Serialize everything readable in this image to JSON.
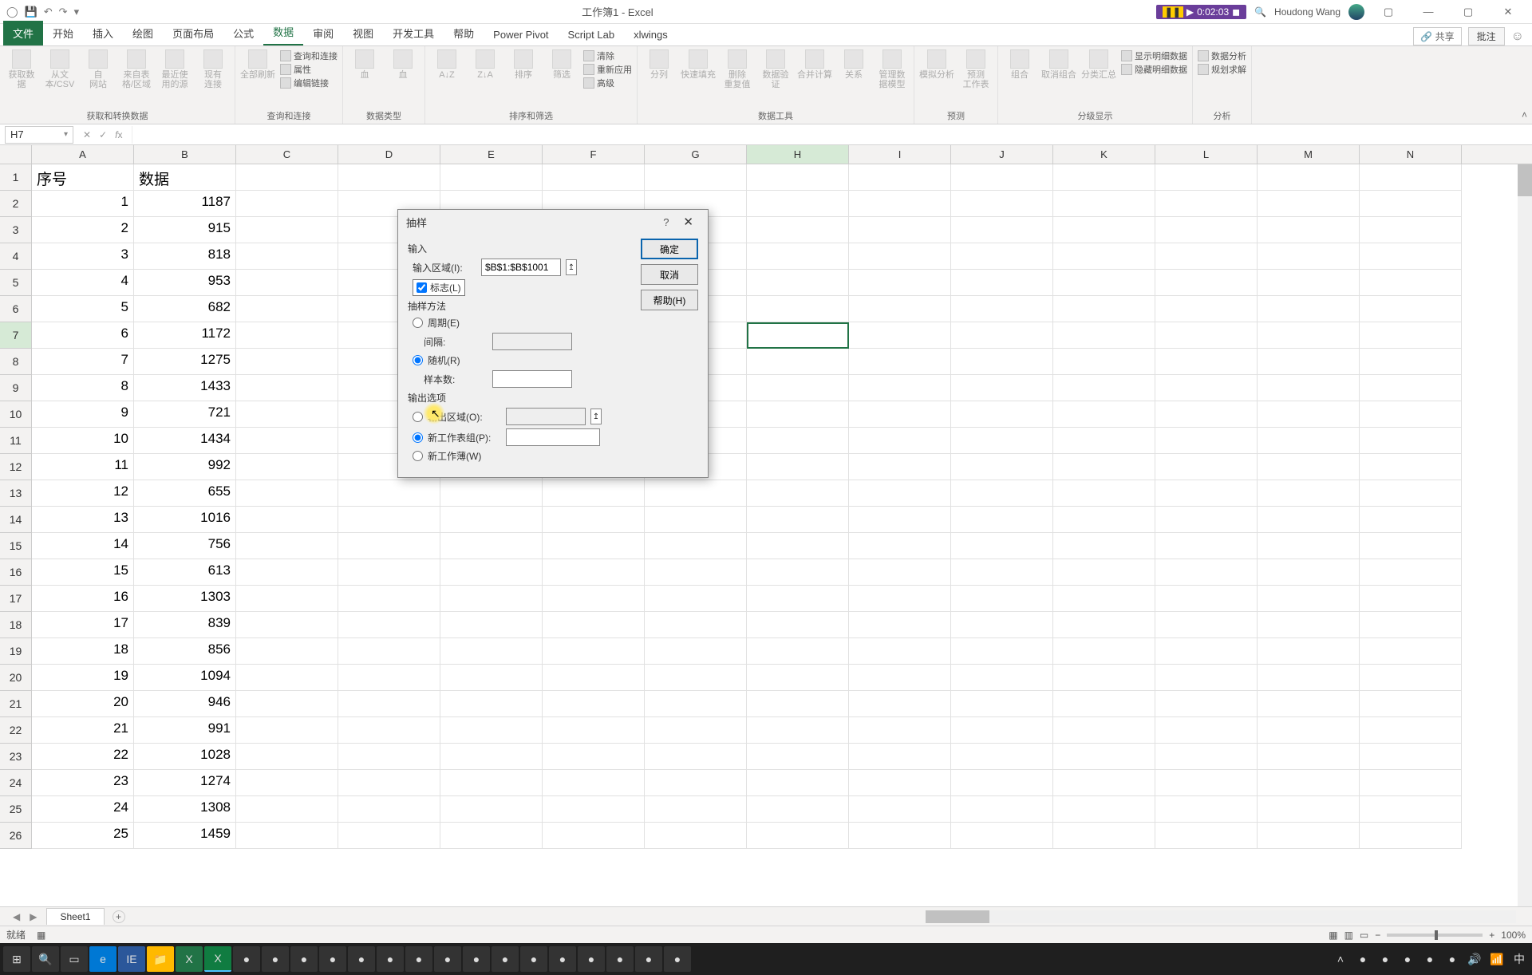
{
  "title": "工作簿1 - Excel",
  "user": "Houdong Wang",
  "recording_time": "0:02:03",
  "tabs": [
    "文件",
    "开始",
    "插入",
    "绘图",
    "页面布局",
    "公式",
    "数据",
    "审阅",
    "视图",
    "开发工具",
    "帮助",
    "Power Pivot",
    "Script Lab",
    "xlwings"
  ],
  "active_tab_index": 6,
  "share_label": "共享",
  "comments_label": "批注",
  "ribbon_groups": {
    "g1": {
      "label": "获取和转换数据",
      "items": [
        "获取数\n据",
        "从文\n本/CSV",
        "自\n网站",
        "来自表\n格/区域",
        "最近使\n用的源",
        "现有\n连接"
      ]
    },
    "g2": {
      "label": "查询和连接",
      "items": [
        "全部刷新"
      ],
      "lines": [
        "查询和连接",
        "属性",
        "编辑链接"
      ]
    },
    "g3": {
      "label": "数据类型",
      "items": [
        "血",
        "血"
      ]
    },
    "g4": {
      "label": "排序和筛选",
      "items": [
        "A↓Z",
        "Z↓A",
        "排序",
        "筛选"
      ],
      "lines": [
        "清除",
        "重新应用",
        "高级"
      ]
    },
    "g5": {
      "label": "数据工具",
      "items": [
        "分列",
        "快速填充",
        "删除\n重复值",
        "数据验\n证",
        "合并计算",
        "关系",
        "管理数\n据模型"
      ]
    },
    "g6": {
      "label": "预测",
      "items": [
        "模拟分析",
        "预测\n工作表"
      ]
    },
    "g7": {
      "label": "分级显示",
      "items": [
        "组合",
        "取消组合",
        "分类汇总"
      ],
      "lines": [
        "显示明细数据",
        "隐藏明细数据"
      ]
    },
    "g8": {
      "label": "分析",
      "lines": [
        "数据分析",
        "规划求解"
      ]
    }
  },
  "namebox": "H7",
  "columns": [
    "A",
    "B",
    "C",
    "D",
    "E",
    "F",
    "G",
    "H",
    "I",
    "J",
    "K",
    "L",
    "M",
    "N"
  ],
  "selected_col_index": 7,
  "selected_row_index": 6,
  "header_row": {
    "A": "序号",
    "B": "数据"
  },
  "data_rows": [
    {
      "r": 2,
      "a": 1,
      "b": 1187
    },
    {
      "r": 3,
      "a": 2,
      "b": 915
    },
    {
      "r": 4,
      "a": 3,
      "b": 818
    },
    {
      "r": 5,
      "a": 4,
      "b": 953
    },
    {
      "r": 6,
      "a": 5,
      "b": 682
    },
    {
      "r": 7,
      "a": 6,
      "b": 1172
    },
    {
      "r": 8,
      "a": 7,
      "b": 1275
    },
    {
      "r": 9,
      "a": 8,
      "b": 1433
    },
    {
      "r": 10,
      "a": 9,
      "b": 721
    },
    {
      "r": 11,
      "a": 10,
      "b": 1434
    },
    {
      "r": 12,
      "a": 11,
      "b": 992
    },
    {
      "r": 13,
      "a": 12,
      "b": 655
    },
    {
      "r": 14,
      "a": 13,
      "b": 1016
    },
    {
      "r": 15,
      "a": 14,
      "b": 756
    },
    {
      "r": 16,
      "a": 15,
      "b": 613
    },
    {
      "r": 17,
      "a": 16,
      "b": 1303
    },
    {
      "r": 18,
      "a": 17,
      "b": 839
    },
    {
      "r": 19,
      "a": 18,
      "b": 856
    },
    {
      "r": 20,
      "a": 19,
      "b": 1094
    },
    {
      "r": 21,
      "a": 20,
      "b": 946
    },
    {
      "r": 22,
      "a": 21,
      "b": 991
    },
    {
      "r": 23,
      "a": 22,
      "b": 1028
    },
    {
      "r": 24,
      "a": 23,
      "b": 1274
    },
    {
      "r": 25,
      "a": 24,
      "b": 1308
    },
    {
      "r": 26,
      "a": 25,
      "b": 1459
    }
  ],
  "sheet_name": "Sheet1",
  "status_left": "就绪",
  "status_acc": "",
  "zoom": "100%",
  "dialog": {
    "title": "抽样",
    "section_input": "输入",
    "input_range_label": "输入区域(I):",
    "input_range_value": "$B$1:$B$1001",
    "labels_label": "标志(L)",
    "section_method": "抽样方法",
    "periodic_label": "周期(E)",
    "interval_label": "间隔:",
    "random_label": "随机(R)",
    "sample_count_label": "样本数:",
    "section_output": "输出选项",
    "output_range_label": "输出区域(O):",
    "new_ws_label": "新工作表组(P):",
    "new_wb_label": "新工作薄(W)",
    "ok": "确定",
    "cancel": "取消",
    "help": "帮助(H)"
  }
}
